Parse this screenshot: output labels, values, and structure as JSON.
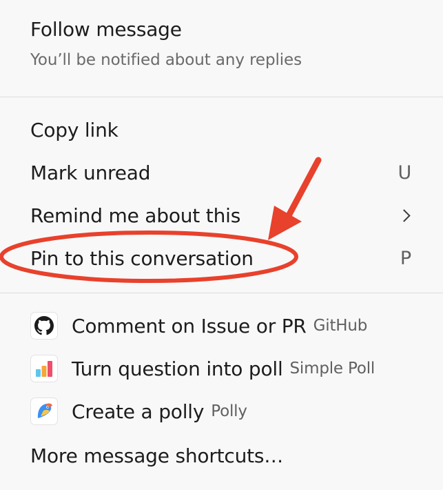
{
  "follow": {
    "title": "Follow message",
    "subtitle": "You’ll be notified about any replies"
  },
  "actions": [
    {
      "label": "Copy link",
      "shortcut": ""
    },
    {
      "label": "Mark unread",
      "shortcut": "U"
    },
    {
      "label": "Remind me about this",
      "shortcut": "",
      "has_submenu": true
    },
    {
      "label": "Pin to this conversation",
      "shortcut": "P"
    }
  ],
  "apps": [
    {
      "action": "Comment on Issue or PR",
      "app": "GitHub",
      "icon": "github-icon"
    },
    {
      "action": "Turn question into poll",
      "app": "Simple Poll",
      "icon": "simple-poll-icon"
    },
    {
      "action": "Create a polly",
      "app": "Polly",
      "icon": "polly-icon"
    }
  ],
  "more_label": "More message shortcuts…",
  "colors": {
    "annotation": "#e8412c",
    "background": "#f8f8f8",
    "text": "#1d1c1d",
    "muted": "#616061"
  }
}
